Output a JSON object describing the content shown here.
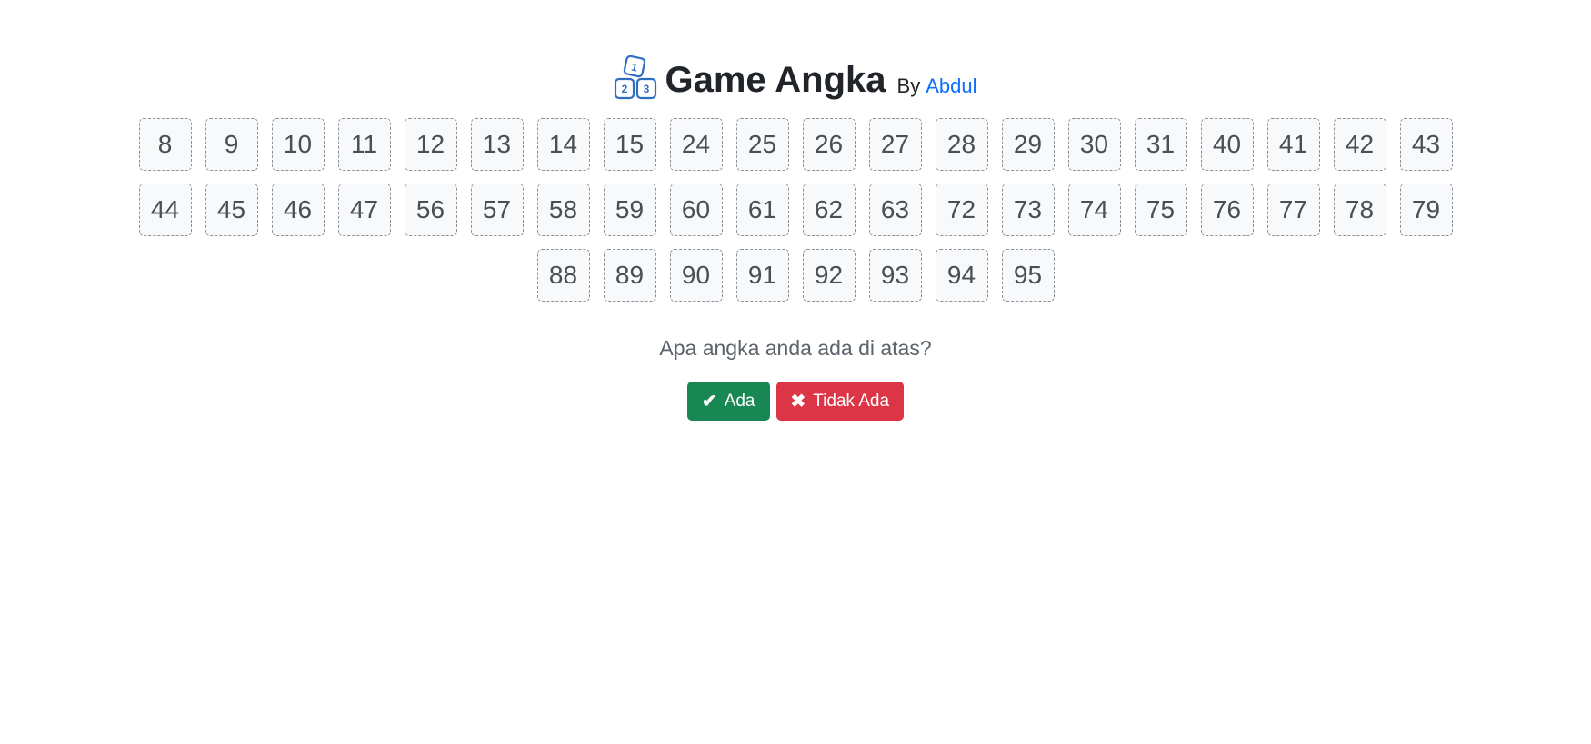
{
  "header": {
    "title": "Game Angka",
    "by_label": "By",
    "author": "Abdul",
    "logo_icon": "number-blocks-icon",
    "logo_digits": [
      "1",
      "2",
      "3"
    ]
  },
  "numbers": {
    "rows": [
      [
        "8",
        "9",
        "10",
        "11",
        "12",
        "13",
        "14",
        "15",
        "24",
        "25",
        "26",
        "27",
        "28",
        "29",
        "30",
        "31",
        "40",
        "41",
        "42",
        "43"
      ],
      [
        "44",
        "45",
        "46",
        "47",
        "56",
        "57",
        "58",
        "59",
        "60",
        "61",
        "62",
        "63",
        "72",
        "73",
        "74",
        "75",
        "76",
        "77",
        "78",
        "79"
      ],
      [
        "88",
        "89",
        "90",
        "91",
        "92",
        "93",
        "94",
        "95"
      ]
    ]
  },
  "question": "Apa angka anda ada di atas?",
  "buttons": {
    "yes": {
      "label": "Ada",
      "icon": "check-icon",
      "color": "#198754"
    },
    "no": {
      "label": "Tidak Ada",
      "icon": "close-icon",
      "color": "#dc3545"
    }
  },
  "colors": {
    "accent": "#0d6efd",
    "cell_border": "#8a9096",
    "cell_background": "#f8f9fa"
  }
}
